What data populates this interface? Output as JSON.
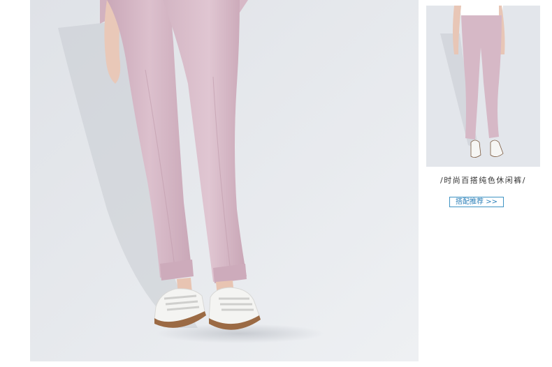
{
  "main_image": {
    "alt": "",
    "colors": {
      "background": "#e4e7ec",
      "pants": "#d6b8c6",
      "shoe": "#f4f4f2",
      "sole_trim": "#9b6a44"
    }
  },
  "thumbnail": {
    "caption": "/时尚百搭纯色休闲裤/"
  },
  "match_button": {
    "label": "搭配推荐 >>",
    "border_color": "#3f93c3",
    "text_color": "#2b7fb8"
  }
}
